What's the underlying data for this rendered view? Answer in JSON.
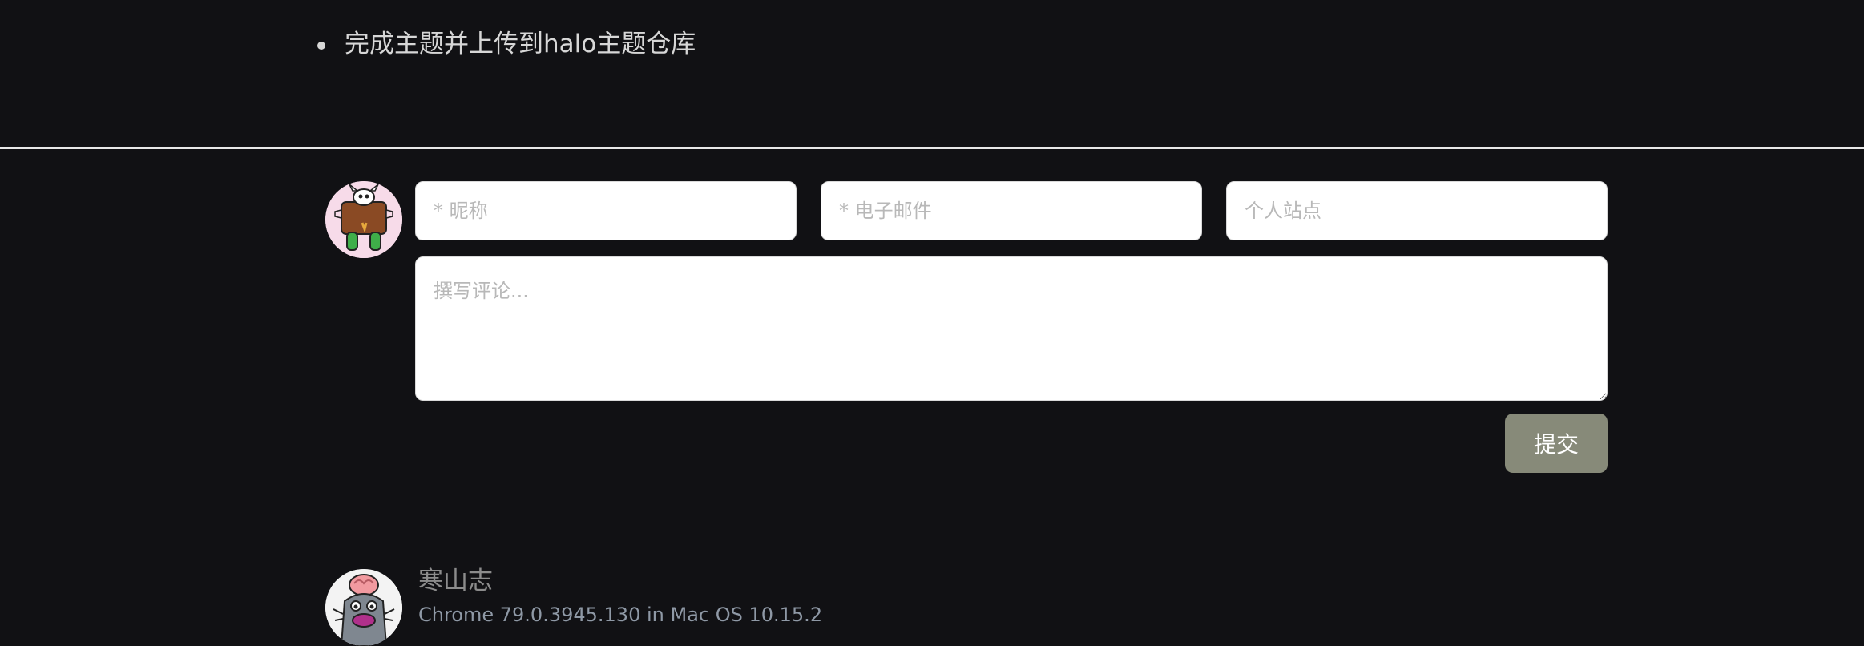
{
  "content": {
    "todo_items": [
      "完成主题并上传到halo主题仓库"
    ]
  },
  "comment_form": {
    "nickname_placeholder": "* 昵称",
    "email_placeholder": "* 电子邮件",
    "site_placeholder": "个人站点",
    "comment_placeholder": "撰写评论...",
    "submit_label": "提交"
  },
  "comments": [
    {
      "author": "寒山志",
      "meta": "Chrome 79.0.3945.130 in Mac OS 10.15.2"
    }
  ],
  "colors": {
    "background": "#111114",
    "submit_button": "#878a79",
    "input_background": "#ffffff"
  }
}
